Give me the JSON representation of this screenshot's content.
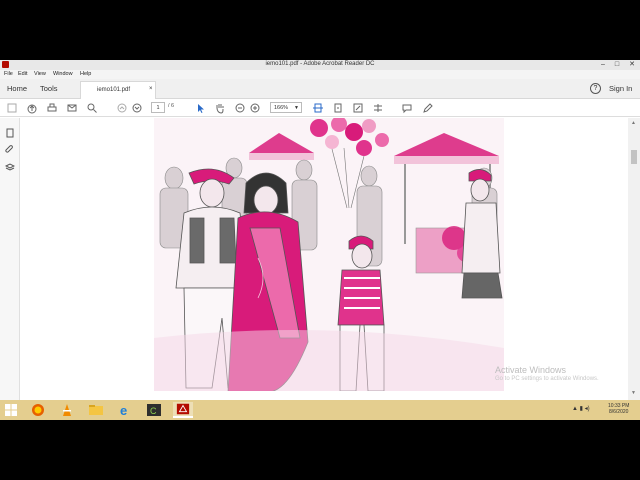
{
  "window": {
    "title": "iemo101.pdf - Adobe Acrobat Reader DC",
    "minimize": "–",
    "maximize": "□",
    "close": "✕"
  },
  "menu": [
    "File",
    "Edit",
    "View",
    "Window",
    "Help"
  ],
  "tabs": {
    "home": "Home",
    "tools": "Tools",
    "document": "iemo101.pdf",
    "close": "×",
    "help": "?",
    "sign_in": "Sign In"
  },
  "toolbar": {
    "page_current": "1",
    "page_total": "/ 6",
    "zoom": "166%"
  },
  "watermark": {
    "line1": "Activate Windows",
    "line2": "Go to PC settings to activate Windows."
  },
  "clock": {
    "time": "10:33 PM",
    "date": "8/6/2020"
  },
  "colors": {
    "accent": "#d81b7a",
    "taskbar": "#e4ce8f"
  }
}
